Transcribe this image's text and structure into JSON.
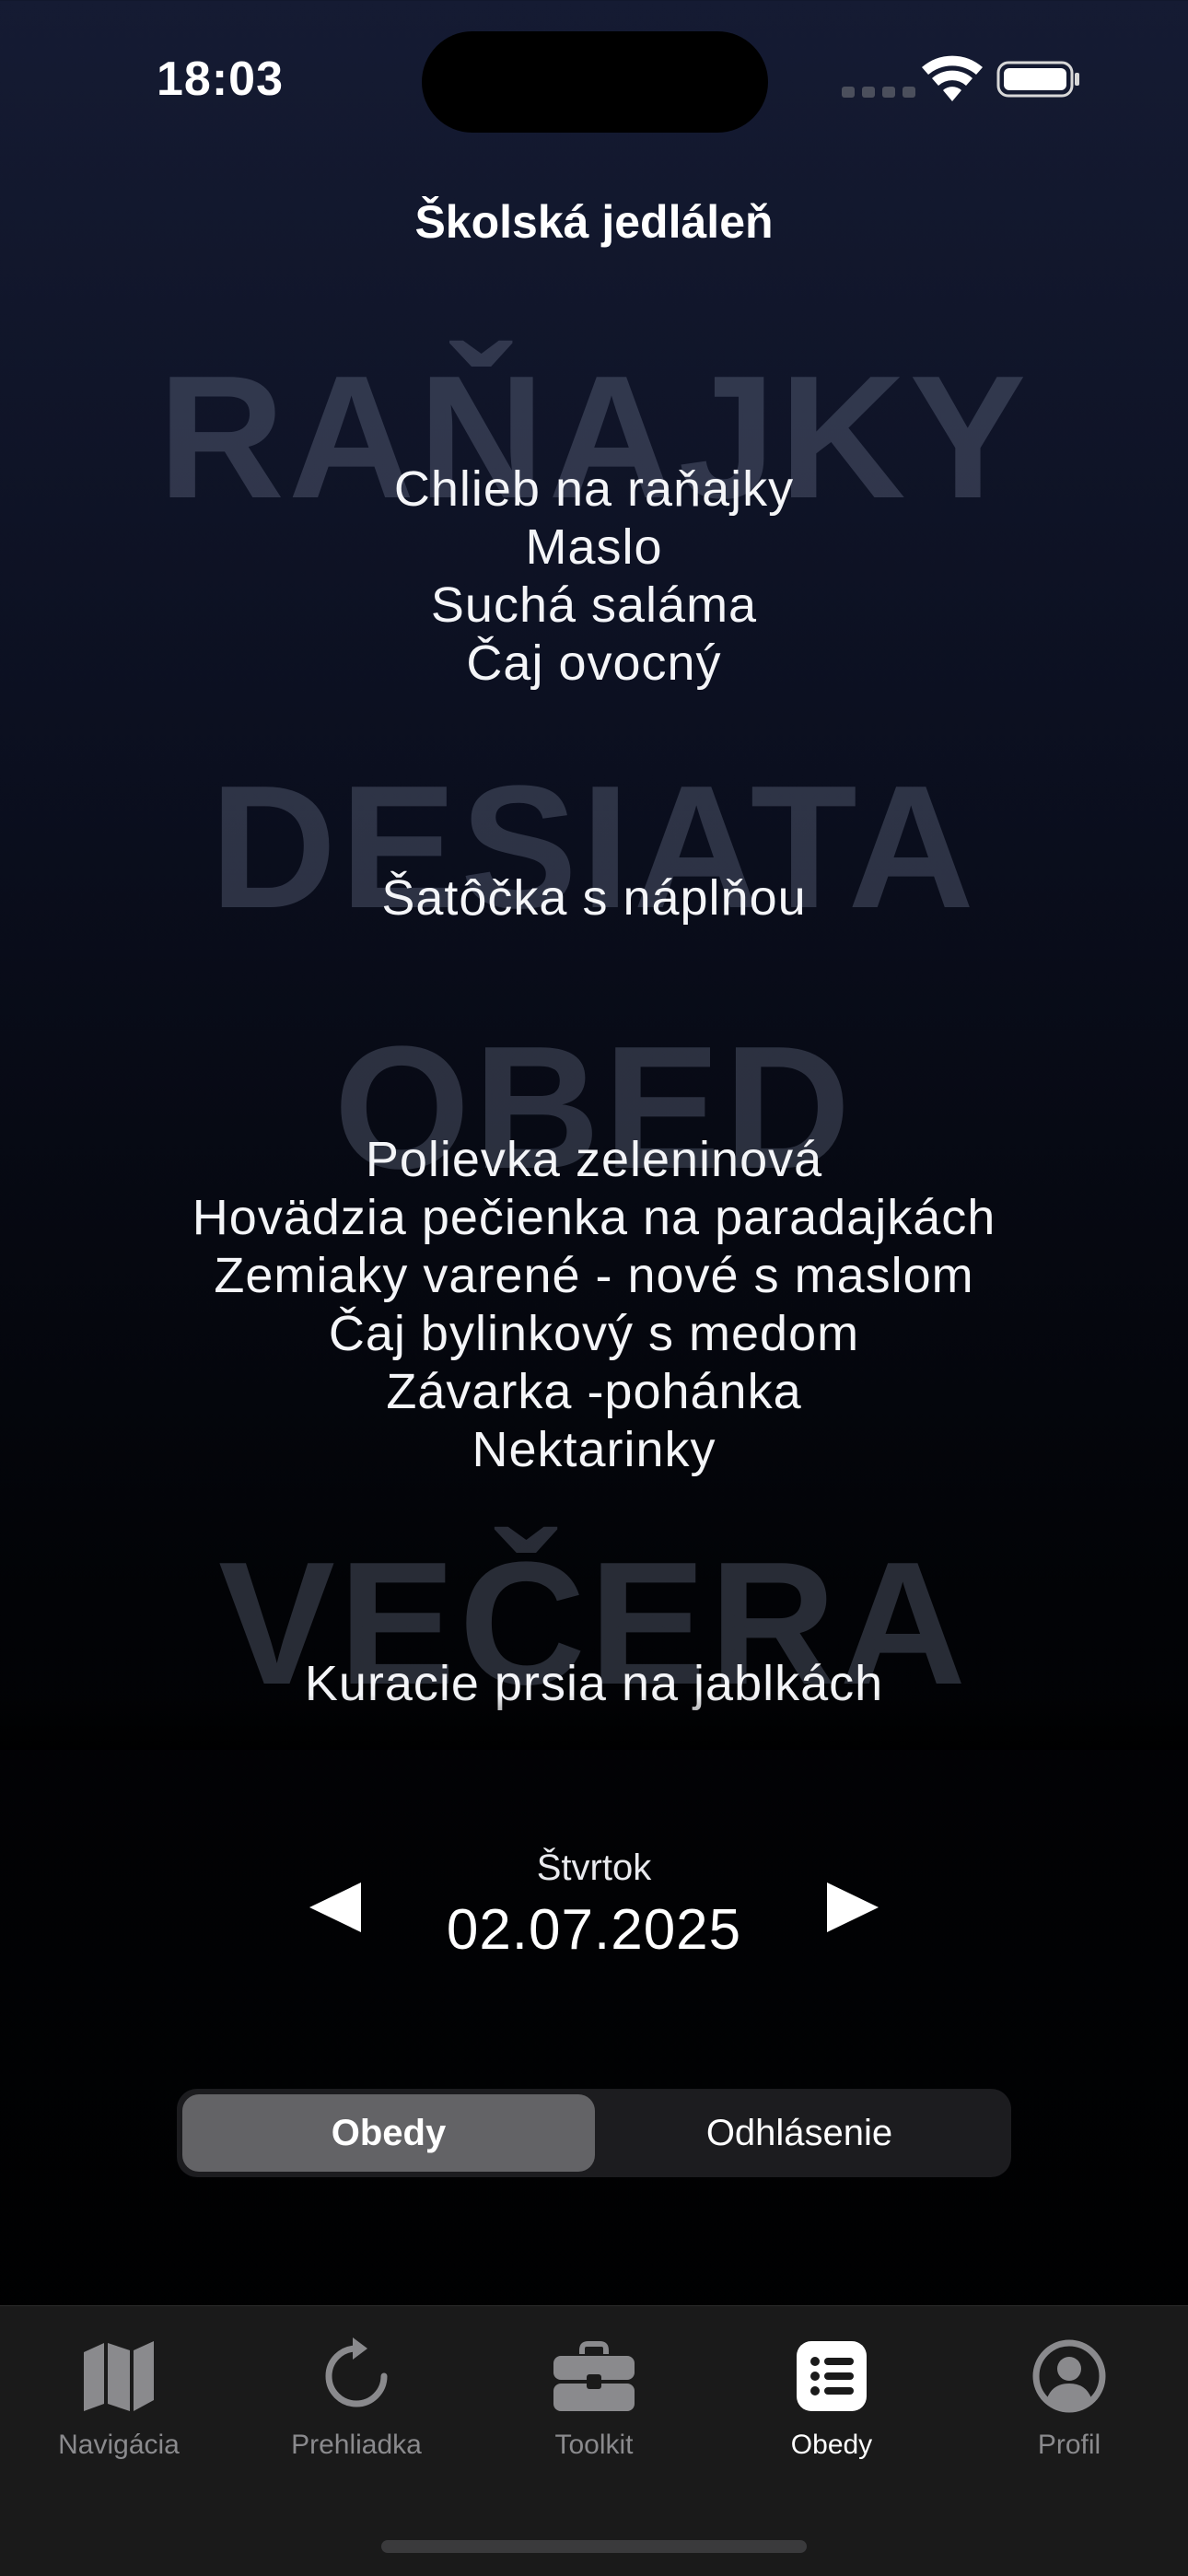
{
  "status_bar": {
    "time": "18:03"
  },
  "app": {
    "title": "Školská jedláleň"
  },
  "meals": [
    {
      "heading": "RAŇAJKY",
      "items": [
        "Chlieb na raňajky",
        "Maslo",
        "Suchá saláma",
        "Čaj ovocný"
      ]
    },
    {
      "heading": "DESIATA",
      "items": [
        "Šatôčka s náplňou"
      ]
    },
    {
      "heading": "OBED",
      "items": [
        "Polievka zeleninová",
        "Hovädzia pečienka na paradajkách",
        "Zemiaky varené - nové s maslom",
        "Čaj bylinkový s medom",
        "Závarka -pohánka",
        "Nektarinky"
      ]
    },
    {
      "heading": "VEČERA",
      "items": [
        "Kuracie prsia na jablkách"
      ]
    }
  ],
  "date_nav": {
    "day": "Štvrtok",
    "date": "02.07.2025",
    "prev_icon": "left-triangle-icon",
    "next_icon": "right-triangle-icon"
  },
  "segments": {
    "selected": "Obedy",
    "items": [
      "Obedy",
      "Odhlásenie"
    ]
  },
  "tabs": [
    {
      "label": "Navigácia",
      "icon": "map-icon",
      "active": false
    },
    {
      "label": "Prehliadka",
      "icon": "refresh-icon",
      "active": false
    },
    {
      "label": "Toolkit",
      "icon": "toolbox-icon",
      "active": false
    },
    {
      "label": "Obedy",
      "icon": "list-icon",
      "active": true
    },
    {
      "label": "Profil",
      "icon": "person-circle-icon",
      "active": false
    }
  ],
  "colors": {
    "active_tab": "#ffffff",
    "inactive_tab": "#8a8a8d",
    "segment_selected": "#636366",
    "tab_bar_bg": "#1a1a1a"
  }
}
